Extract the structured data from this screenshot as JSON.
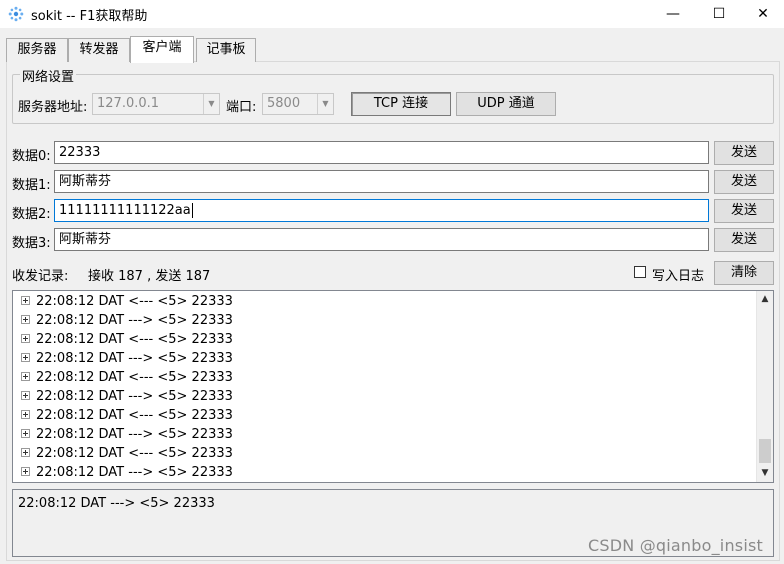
{
  "window": {
    "title": "sokit -- F1获取帮助",
    "icon": "gear-icon",
    "minimize": "—",
    "maximize": "☐",
    "close": "✕"
  },
  "tabs": [
    {
      "label": "服务器",
      "active": false
    },
    {
      "label": "转发器",
      "active": false
    },
    {
      "label": "客户端",
      "active": true
    },
    {
      "label": "记事板",
      "active": false
    }
  ],
  "network": {
    "group_title": "网络设置",
    "server_addr_label": "服务器地址:",
    "server_addr_value": "127.0.0.1",
    "port_label": "端口:",
    "port_value": "5800",
    "tcp_button": "TCP 连接",
    "udp_button": "UDP 通道"
  },
  "data_rows": [
    {
      "label": "数据0:",
      "value": "22333",
      "send": "发送"
    },
    {
      "label": "数据1:",
      "value": "阿斯蒂芬",
      "send": "发送"
    },
    {
      "label": "数据2:",
      "value": "11111111111122aa",
      "send": "发送"
    },
    {
      "label": "数据3:",
      "value": "阿斯蒂芬",
      "send": "发送"
    }
  ],
  "log": {
    "label": "收发记录:",
    "stats": "接收 187 , 发送 187",
    "write_log_label": "写入日志",
    "write_log_checked": false,
    "clear_button": "清除",
    "entries": [
      "22:08:12 DAT <--- <5> 22333",
      "22:08:12 DAT ---> <5> 22333",
      "22:08:12 DAT <--- <5> 22333",
      "22:08:12 DAT ---> <5> 22333",
      "22:08:12 DAT <--- <5> 22333",
      "22:08:12 DAT ---> <5> 22333",
      "22:08:12 DAT <--- <5> 22333",
      "22:08:12 DAT ---> <5> 22333",
      "22:08:12 DAT <--- <5> 22333",
      "22:08:12 DAT ---> <5> 22333"
    ],
    "detail": "22:08:12 DAT ---> <5> 22333"
  },
  "watermark": "CSDN @qianbo_insist"
}
